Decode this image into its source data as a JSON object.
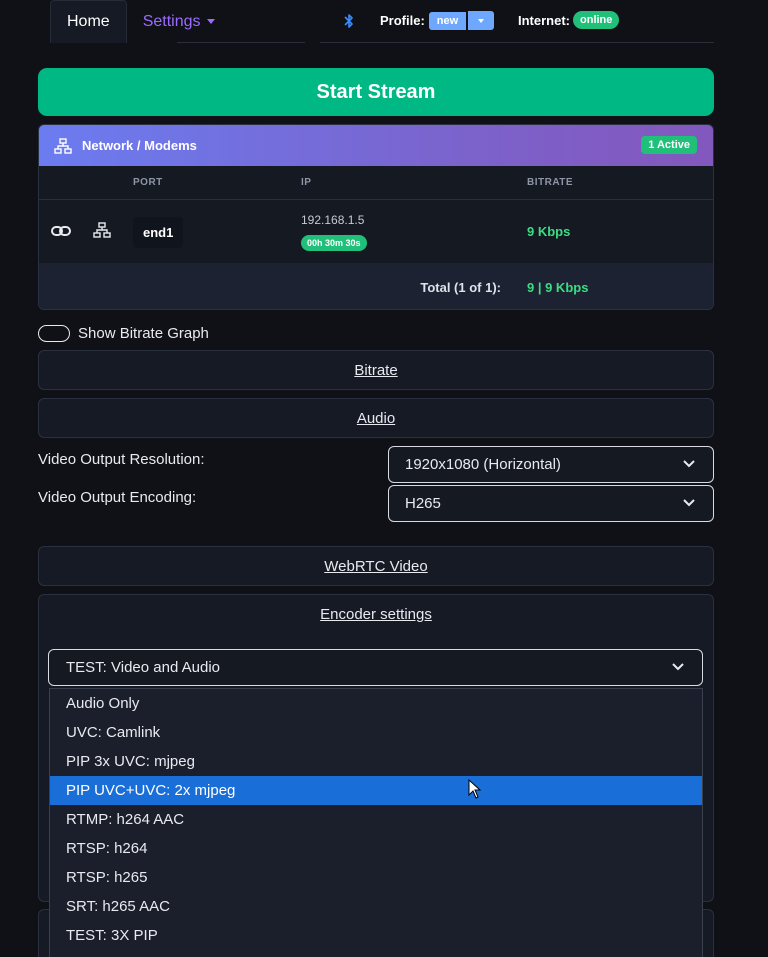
{
  "nav": {
    "home_label": "Home",
    "settings_label": "Settings",
    "profile_label": "Profile:",
    "profile_value": "new",
    "internet_label": "Internet:",
    "internet_status": "online"
  },
  "start_button_label": "Start Stream",
  "network": {
    "title": "Network / Modems",
    "active_badge": "1 Active",
    "columns": [
      "PORT",
      "IP",
      "BITRATE"
    ],
    "rows": [
      {
        "port": "end1",
        "ip": "192.168.1.5",
        "uptime": "00h 30m 30s",
        "bitrate": "9 Kbps"
      }
    ],
    "total_label": "Total (1 of 1):",
    "total_value": "9 | 9 Kbps"
  },
  "bitrate_graph_toggle_label": "Show Bitrate Graph",
  "sections": {
    "bitrate": "Bitrate",
    "audio": "Audio",
    "webrtc": "WebRTC Video",
    "encoder": "Encoder settings"
  },
  "video_output": {
    "resolution_label": "Video Output Resolution:",
    "resolution_value": "1920x1080 (Horizontal)",
    "encoding_label": "Video Output Encoding:",
    "encoding_value": "H265"
  },
  "encoder": {
    "selected_pipeline": "TEST: Video and Audio",
    "options": [
      "Audio Only",
      "UVC: Camlink",
      "PIP 3x UVC: mjpeg",
      "PIP UVC+UVC: 2x mjpeg",
      "RTMP: h264 AAC",
      "RTSP: h264",
      "RTSP: h265",
      "SRT: h265 AAC",
      "TEST: 3X PIP"
    ],
    "highlighted_option": "PIP UVC+UVC: 2x mjpeg"
  },
  "colors": {
    "accent_green": "#00b884",
    "status_green": "#20c07a",
    "bitrate_green": "#3ddc84",
    "settings_purple": "#9b6bff",
    "profile_blue": "#6ea8fe",
    "highlight_blue": "#1a6ed8"
  },
  "icons": [
    "bluetooth-icon",
    "network-icon",
    "link-icon",
    "chevron-down-icon",
    "mouse-cursor-icon"
  ]
}
